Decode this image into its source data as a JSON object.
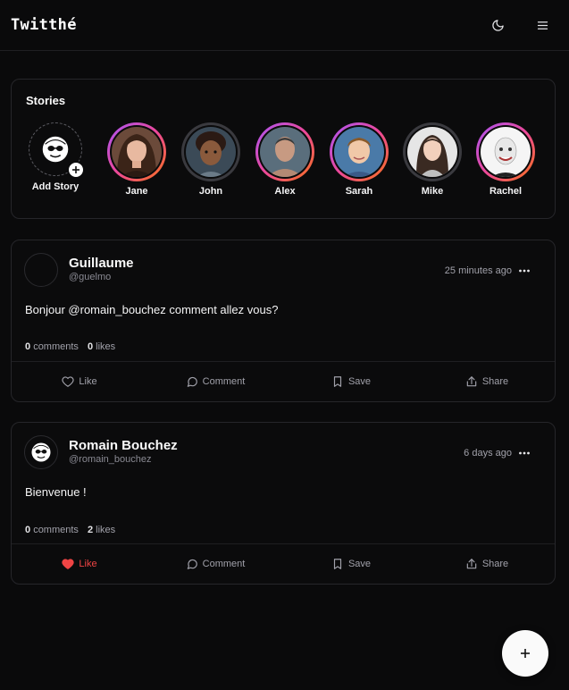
{
  "app": {
    "brand": "Twitthé"
  },
  "stories": {
    "title": "Stories",
    "add_label": "Add Story",
    "items": [
      {
        "name": "Jane",
        "ring": "grad"
      },
      {
        "name": "John",
        "ring": "plain"
      },
      {
        "name": "Alex",
        "ring": "grad"
      },
      {
        "name": "Sarah",
        "ring": "grad"
      },
      {
        "name": "Mike",
        "ring": "plain"
      },
      {
        "name": "Rachel",
        "ring": "grad"
      }
    ]
  },
  "posts": [
    {
      "name": "Guillaume",
      "handle": "@guelmo",
      "time": "25 minutes ago",
      "text": "Bonjour @romain_bouchez comment allez vous?",
      "comments_count": "0",
      "comments_label": "comments",
      "likes_count": "0",
      "likes_label": "likes",
      "liked": false
    },
    {
      "name": "Romain Bouchez",
      "handle": "@romain_bouchez",
      "time": "6 days ago",
      "text": "Bienvenue !",
      "comments_count": "0",
      "comments_label": "comments",
      "likes_count": "2",
      "likes_label": "likes",
      "liked": true
    }
  ],
  "actions": {
    "like": "Like",
    "comment": "Comment",
    "save": "Save",
    "share": "Share"
  },
  "colors": {
    "accent_like": "#ef4444",
    "background": "#0a0a0b",
    "story_ring_gradient": [
      "#a855f7",
      "#ec4899",
      "#f97316"
    ]
  },
  "icons": [
    "moon-icon",
    "menu-icon",
    "heart-icon",
    "comment-icon",
    "bookmark-icon",
    "share-icon",
    "more-icon",
    "plus-icon"
  ]
}
